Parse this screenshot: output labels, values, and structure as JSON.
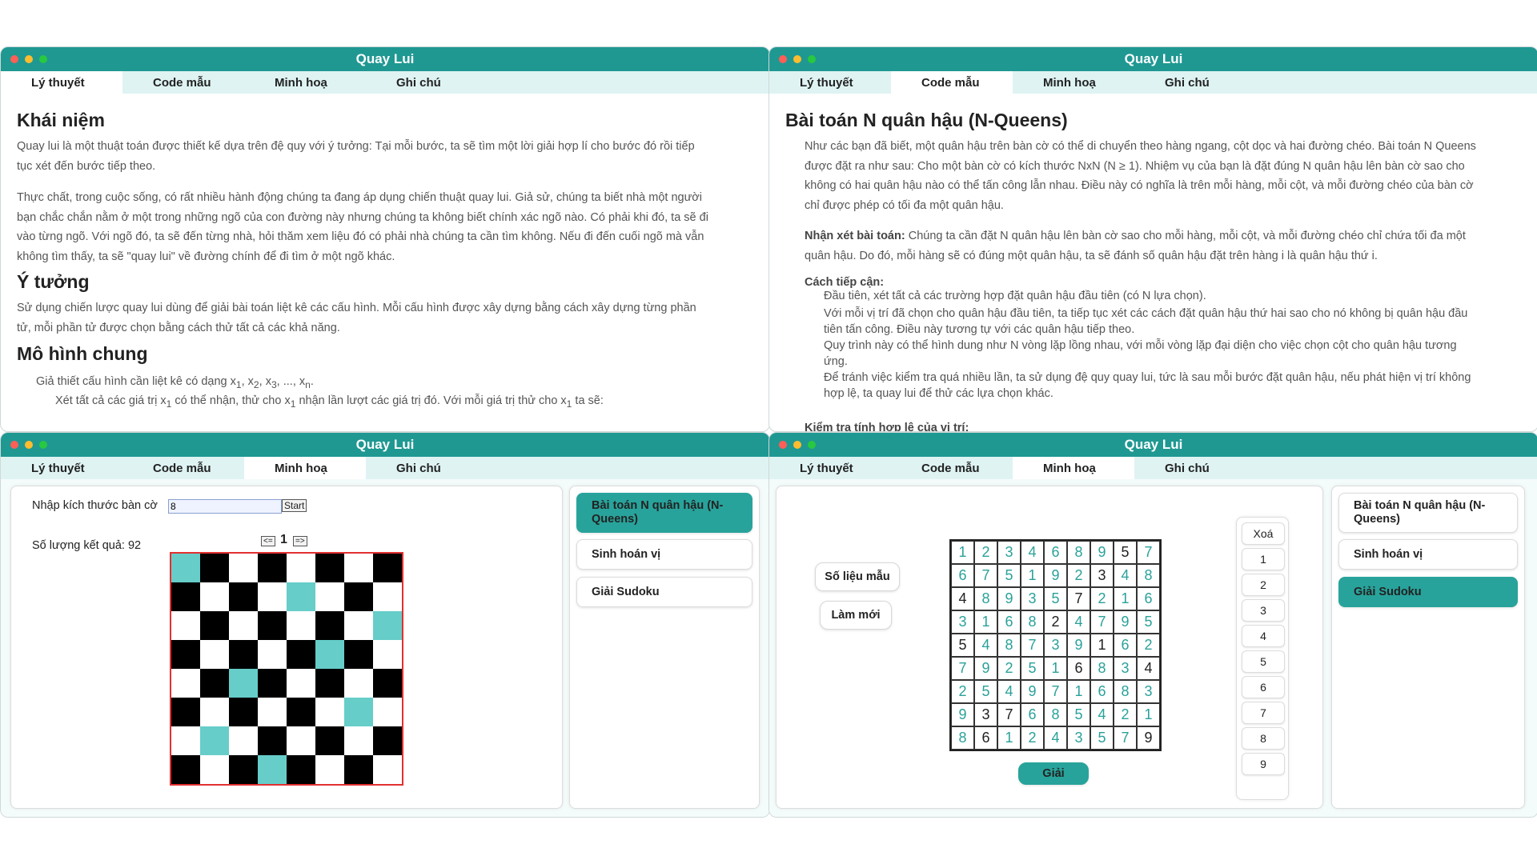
{
  "app": {
    "title": "Quay Lui"
  },
  "tabs": [
    "Lý thuyết",
    "Code mẫu",
    "Minh hoạ",
    "Ghi chú"
  ],
  "theory": {
    "heading1": "Khái niệm",
    "p1a": "Quay lui là một thuật toán được thiết kế dựa trên đệ quy với ý tưởng: Tại mỗi bước, ta sẽ tìm một lời giải hợp lí cho bước đó rồi tiếp",
    "p1b": "tục xét đến bước tiếp theo.",
    "p2a": "Thực chất, trong cuộc sống, có rất nhiều hành động chúng ta đang áp dụng chiến thuật quay lui. Giả sử, chúng ta biết nhà một người",
    "p2b": "bạn chắc chắn nằm ở một trong những ngõ của con đường này nhưng chúng ta không biết chính xác ngõ nào. Có phải khi đó, ta sẽ đi",
    "p2c": "vào từng ngõ. Với ngõ đó, ta sẽ đến từng nhà, hỏi thăm xem liệu đó có phải nhà chúng ta cần tìm không. Nếu đi đến cuối ngõ mà vẫn",
    "p2d": "không tìm thấy, ta sẽ \"quay lui\" về đường chính để đi tìm ở một ngõ khác.",
    "heading2": "Ý tưởng",
    "p3a": "Sử dụng chiến lược quay lui dùng để giải bài toán liệt kê các cấu hình. Mỗi cấu hình được xây dựng bằng cách xây dựng từng phần",
    "p3b": "tử, mỗi phần tử được chọn bằng cách thử tất cả các khả năng.",
    "heading3": "Mô hình chung",
    "l1_pre": "Giả thiết cấu hình cần liệt kê có dạng x",
    "l1_s1": "1",
    "l1_c1": ", x",
    "l1_s2": "2",
    "l1_c2": ", x",
    "l1_s3": "3",
    "l1_c3": ", ..., x",
    "l1_sn": "n",
    "l1_end": ".",
    "l2_pre": "Xét tất cả các giá trị x",
    "l2_s1": "1",
    "l2_mid": " có thể nhận, thử cho x",
    "l2_s2": "1",
    "l2_mid2": " nhận lần lượt các giá trị đó. Với mỗi giá trị thử cho x",
    "l2_s3": "1",
    "l2_end": " ta sẽ:"
  },
  "code": {
    "heading": "Bài toán N quân hậu (N-Queens)",
    "p1a": "Như các bạn đã biết, một quân hậu trên bàn cờ có thể di chuyển theo hàng ngang, cột dọc và hai đường chéo. Bài toán N Queens",
    "p1b": "được đặt ra như sau: Cho một bàn cờ có kích thước NxN (N ≥ 1). Nhiệm vụ của bạn là đặt đúng N quân hậu lên bàn cờ sao cho",
    "p1c": "không có hai quân hậu nào có thể tấn công lẫn nhau. Điều này có nghĩa là trên mỗi hàng, mỗi cột, và mỗi đường chéo của bàn cờ",
    "p1d": "chỉ được phép có tối đa một quân hậu.",
    "obs_label": "Nhận xét bài toán:",
    "obs_a": " Chúng ta cần đặt N quân hậu lên bàn cờ sao cho mỗi hàng, mỗi cột, và mỗi đường chéo chỉ chứa tối đa một",
    "obs_b": "quân hậu. Do đó, mỗi hàng sẽ có đúng một quân hậu, ta sẽ đánh số quân hậu đặt trên hàng i là quân hậu thứ i.",
    "approach_label": "Cách tiếp cận:",
    "a1": "Đầu tiên, xét tất cả các trường hợp đặt quân hậu đầu tiên (có N lựa chọn).",
    "a2a": "Với mỗi vị trí đã chọn cho quân hậu đầu tiên, ta tiếp tục xét các cách đặt quân hậu thứ hai sao cho nó không bị quân hậu đầu",
    "a2b": "tiên tấn công. Điều này tương tự với các quân hậu tiếp theo.",
    "a3a": "Quy trình này có thể hình dung như N vòng lặp lồng nhau, với mỗi vòng lặp đại diện cho việc chọn cột cho quân hậu tương",
    "a3b": "ứng.",
    "a4a": "Để tránh việc kiểm tra quá nhiều lần, ta sử dụng đệ quy quay lui, tức là sau mỗi bước đặt quân hậu, nếu phát hiện vị trí không",
    "a4b": "hợp lệ, ta quay lui để thử các lựa chọn khác.",
    "check_label": "Kiểm tra tính hợp lệ của vị trí:"
  },
  "nqueens": {
    "size_label": "Nhập kích thước bàn cờ",
    "size_value": "8",
    "start_label": "Start",
    "count_label": "Số lượng kết quả: 92",
    "prev_label": "<=",
    "next_label": "=>",
    "page": "1",
    "queens": [
      0,
      4,
      7,
      5,
      2,
      6,
      1,
      3
    ],
    "colors": {
      "dark": "#000000",
      "light": "#ffffff",
      "queen": "#66cdc9",
      "border": "#e23030"
    }
  },
  "menu": {
    "item1": "Bài toán N quân hậu (N-Queens)",
    "item2": "Sinh hoán vị",
    "item3": "Giải Sudoku"
  },
  "sudoku": {
    "sample_label": "Số liệu mẫu",
    "new_label": "Làm mới",
    "solve_label": "Giải",
    "clear_label": "Xoá",
    "numpad": [
      "1",
      "2",
      "3",
      "4",
      "5",
      "6",
      "7",
      "8",
      "9"
    ],
    "grid": [
      [
        "1",
        "2",
        "3",
        "4",
        "6",
        "8",
        "9",
        "5",
        "7"
      ],
      [
        "6",
        "7",
        "5",
        "1",
        "9",
        "2",
        "3",
        "4",
        "8"
      ],
      [
        "4",
        "8",
        "9",
        "3",
        "5",
        "7",
        "2",
        "1",
        "6"
      ],
      [
        "3",
        "1",
        "6",
        "8",
        "2",
        "4",
        "7",
        "9",
        "5"
      ],
      [
        "5",
        "4",
        "8",
        "7",
        "3",
        "9",
        "1",
        "6",
        "2"
      ],
      [
        "7",
        "9",
        "2",
        "5",
        "1",
        "6",
        "8",
        "3",
        "4"
      ],
      [
        "2",
        "5",
        "4",
        "9",
        "7",
        "1",
        "6",
        "8",
        "3"
      ],
      [
        "9",
        "3",
        "7",
        "6",
        "8",
        "5",
        "4",
        "2",
        "1"
      ],
      [
        "8",
        "6",
        "1",
        "2",
        "4",
        "3",
        "5",
        "7",
        "9"
      ]
    ],
    "given": [
      "000000010",
      "000000100",
      "100001000",
      "000010000",
      "100000100",
      "000001001",
      "000000000",
      "011000000",
      "010000001"
    ]
  }
}
